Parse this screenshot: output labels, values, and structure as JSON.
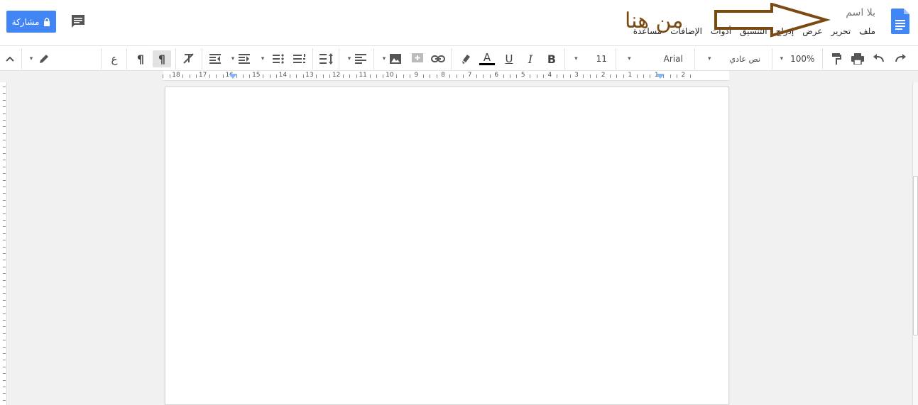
{
  "document": {
    "title": "بلا اسم"
  },
  "menu": [
    "ملف",
    "تحرير",
    "عرض",
    "إدراج",
    "التنسيق",
    "أدوات",
    "الإضافات",
    "مساعدة"
  ],
  "annotation": {
    "text": "من هنا"
  },
  "share": {
    "label": "مشاركة"
  },
  "toolbar": {
    "zoom": "100%",
    "style": "نص عادي",
    "font": "Arial",
    "font_size": "11",
    "input_tool": "ع"
  },
  "ruler": {
    "numbers": [
      "18",
      "17",
      "16",
      "15",
      "14",
      "13",
      "12",
      "11",
      "10",
      "9",
      "8",
      "7",
      "6",
      "5",
      "4",
      "3",
      "2",
      "1",
      "1",
      "2"
    ]
  },
  "colors": {
    "accent": "#4285f4",
    "annotation": "#7a4a12"
  },
  "icons": [
    "doc-icon",
    "comment-icon",
    "lock-icon",
    "redo-icon",
    "undo-icon",
    "print-icon",
    "paint-format-icon",
    "bold-icon",
    "italic-icon",
    "underline-icon",
    "text-color-icon",
    "highlight-icon",
    "link-icon",
    "comment-add-icon",
    "image-icon",
    "align-icon",
    "line-spacing-icon",
    "numbered-list-icon",
    "bulleted-list-icon",
    "indent-icon",
    "outdent-icon",
    "clear-format-icon",
    "ltr-icon",
    "rtl-icon",
    "pencil-icon",
    "collapse-icon"
  ]
}
